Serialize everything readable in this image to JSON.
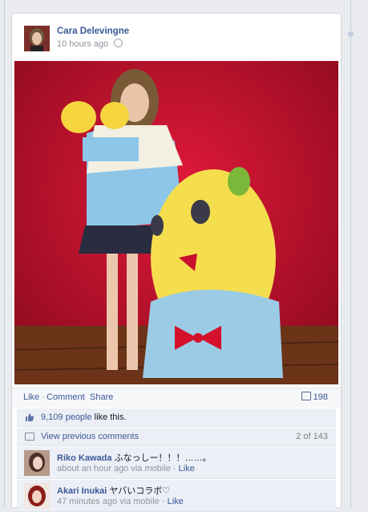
{
  "post": {
    "author": "Cara Delevingne",
    "timestamp": "10 hours ago",
    "privacy_icon": "globe-icon",
    "colors": {
      "link": "#3b5998",
      "photo_backdrop": "#c8102e"
    }
  },
  "actions": {
    "like": "Like",
    "comment": "Comment",
    "share": "Share",
    "sep": "·",
    "comment_count": "198"
  },
  "likes": {
    "count": "9,109 people",
    "suffix": " like this."
  },
  "previous": {
    "label": "View previous comments",
    "count": "2 of 143"
  },
  "comments": [
    {
      "name": "Riko Kawada",
      "text": "ふなっしー！！！……。",
      "meta": "about an hour ago via mobile · ",
      "like": "Like"
    },
    {
      "name": "Akari Inukai",
      "text": "ヤバいコラボ♡",
      "meta": "47 minutes ago via mobile · ",
      "like": "Like"
    }
  ]
}
